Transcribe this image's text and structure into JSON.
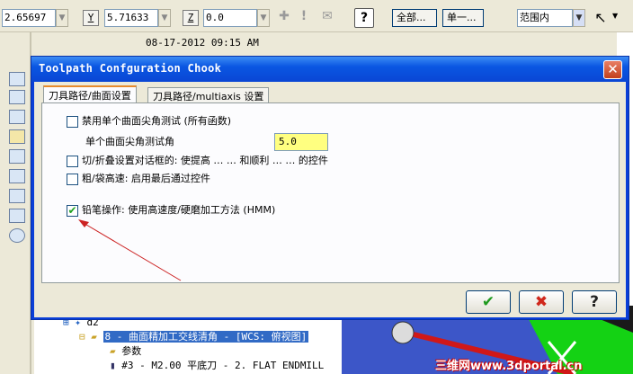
{
  "toolbar": {
    "x_value": "2.65697",
    "y_label": "Y",
    "y_value": "5.71633",
    "z_label": "Z",
    "z_value": "0.0",
    "select_all_label": "全部...",
    "select_one_label": "单一...",
    "range_value": "范围内",
    "help_icon": "?"
  },
  "datetime": "08-17-2012 09:15 AM",
  "dialog": {
    "title": "Toolpath Confguration Chook",
    "close_icon": "✕",
    "tabs": [
      {
        "label": "刀具路径/曲面设置",
        "active": true
      },
      {
        "label": "刀具路径/multiaxis 设置",
        "active": false
      }
    ],
    "options": {
      "disable_single_angle": {
        "label": "禁用单个曲面尖角测试 (所有函数)",
        "checked": false
      },
      "single_angle_test_label": "单个曲面尖角测试角",
      "single_angle_value": "5.0",
      "cut_fold": {
        "label": "切/折叠设置对话框的: 使提高 … … 和顺利 … … 的控件",
        "checked": false
      },
      "rough_high_speed": {
        "label": "粗/袋高速: 启用最后通过控件",
        "checked": false
      },
      "pencil_ops": {
        "label": "铅笔操作: 使用高速度/硬磨加工方法 (HMM)",
        "checked": true
      }
    },
    "buttons": {
      "ok_icon": "✔",
      "cancel_icon": "✖",
      "help_icon": "?"
    }
  },
  "tree": {
    "node_d2": "d2",
    "node_op": "8 - 曲面精加工交线清角 - [WCS: 俯视图]",
    "node_params": "参数",
    "node_tool": "#3 - M2.00 平底刀 - 2. FLAT ENDMILL"
  },
  "watermark": "三维网www.3dportal.cn",
  "colors": {
    "titlebar": "#0a56e2",
    "input_highlight": "#ffff80",
    "arrow": "#cc2222",
    "ok_green": "#1f9a1f",
    "cancel_red": "#d0281c"
  }
}
